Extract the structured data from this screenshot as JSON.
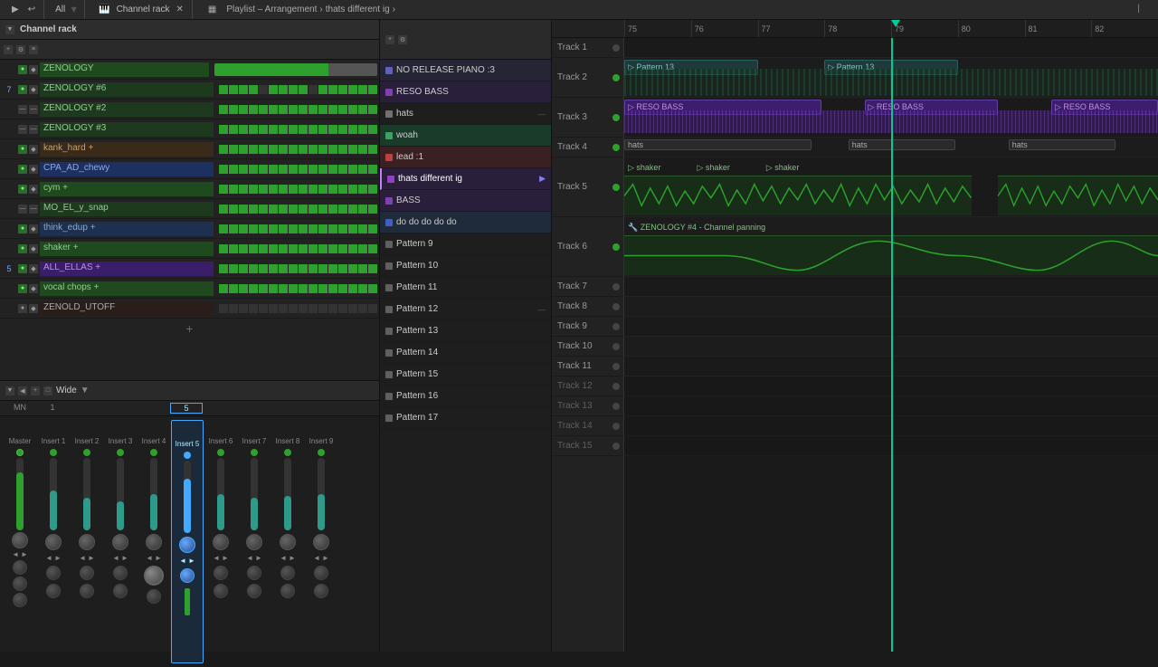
{
  "topbar": {
    "left_controls": [
      "▶",
      "↩"
    ],
    "channel_rack_label": "Channel rack",
    "playlist_label": "Playlist – Arrangement",
    "breadcrumb_separator": "›",
    "project_name": "thats different ig",
    "all_label": "All"
  },
  "channel_rack": {
    "title": "Channel rack",
    "channels": [
      {
        "num": "",
        "name": "ZENOLOGY",
        "style": "green",
        "pads": 16
      },
      {
        "num": "7",
        "name": "ZENOLOGY #6",
        "style": "green",
        "pads": 16
      },
      {
        "num": "",
        "name": "ZENOLOGY #2",
        "style": "green",
        "pads": 16
      },
      {
        "num": "",
        "name": "ZENOLOGY #3",
        "style": "green",
        "pads": 16
      },
      {
        "num": "",
        "name": "kank_hard +",
        "style": "green",
        "pads": 16
      },
      {
        "num": "",
        "name": "CPA_AD_chewy",
        "style": "green",
        "pads": 16
      },
      {
        "num": "",
        "name": "cym +",
        "style": "green",
        "pads": 16
      },
      {
        "num": "",
        "name": "MO_EL_y_snap",
        "style": "green",
        "pads": 16
      },
      {
        "num": "",
        "name": "think_edup +",
        "style": "green",
        "pads": 16
      },
      {
        "num": "",
        "name": "shaker +",
        "style": "green",
        "pads": 16
      },
      {
        "num": "5",
        "name": "ALL_ELLAS +",
        "style": "green",
        "pads": 16
      },
      {
        "num": "",
        "name": "vocal chops +",
        "style": "green",
        "pads": 16
      },
      {
        "num": "",
        "name": "ZENOLD_UTOFF",
        "style": "green",
        "pads": 16
      }
    ]
  },
  "mixer": {
    "label": "Wide",
    "channels": [
      "Master",
      "Insert 1",
      "Insert 2",
      "Insert 3",
      "Insert 4",
      "Insert 5",
      "Insert 6",
      "Insert 7",
      "Insert 8",
      "Insert 9"
    ],
    "active_channel": 5
  },
  "patterns": [
    {
      "name": "NO RELEASE PIANO :3",
      "color": "#6060c0",
      "active": false
    },
    {
      "name": "RESO BASS",
      "color": "#8040b0",
      "active": false
    },
    {
      "name": "hats",
      "color": "#606060",
      "active": false
    },
    {
      "name": "woah",
      "color": "#40a060",
      "active": false
    },
    {
      "name": "lead :1",
      "color": "#c04040",
      "active": false
    },
    {
      "name": "thats different ig",
      "color": "#9040c0",
      "active": true
    },
    {
      "name": "BASS",
      "color": "#8040b0",
      "active": false
    },
    {
      "name": "do do do do do",
      "color": "#4060c0",
      "active": false
    },
    {
      "name": "Pattern 9",
      "color": "#606060",
      "active": false
    },
    {
      "name": "Pattern 10",
      "color": "#606060",
      "active": false
    },
    {
      "name": "Pattern 11",
      "color": "#606060",
      "active": false
    },
    {
      "name": "Pattern 12",
      "color": "#606060",
      "active": false
    },
    {
      "name": "Pattern 13",
      "color": "#606060",
      "active": false
    },
    {
      "name": "Pattern 14",
      "color": "#606060",
      "active": false
    },
    {
      "name": "Pattern 15",
      "color": "#606060",
      "active": false
    },
    {
      "name": "Pattern 16",
      "color": "#606060",
      "active": false
    },
    {
      "name": "Pattern 17",
      "color": "#606060",
      "active": false
    }
  ],
  "arrangement": {
    "title": "Playlist – Arrangement",
    "project": "thats different ig",
    "tracks": [
      {
        "id": 1,
        "label": "Track 1",
        "height": "small"
      },
      {
        "id": 2,
        "label": "Track 2",
        "height": "small"
      },
      {
        "id": 3,
        "label": "Track 3",
        "height": "small"
      },
      {
        "id": 4,
        "label": "Track 4",
        "height": "small"
      },
      {
        "id": 5,
        "label": "Track 5",
        "height": "tall"
      },
      {
        "id": 6,
        "label": "Track 6",
        "height": "tall"
      },
      {
        "id": 7,
        "label": "Track 7",
        "height": "small"
      },
      {
        "id": 8,
        "label": "Track 8",
        "height": "small"
      },
      {
        "id": 9,
        "label": "Track 9",
        "height": "small"
      },
      {
        "id": 10,
        "label": "Track 10",
        "height": "small"
      },
      {
        "id": 11,
        "label": "Track 11",
        "height": "small"
      },
      {
        "id": 12,
        "label": "Track 12",
        "height": "small"
      },
      {
        "id": 13,
        "label": "Track 13",
        "height": "small"
      },
      {
        "id": 14,
        "label": "Track 14",
        "height": "small"
      },
      {
        "id": 15,
        "label": "Track 15",
        "height": "small"
      }
    ],
    "timeline_marks": [
      "75",
      "76",
      "77",
      "78",
      "79",
      "80",
      "81",
      "82"
    ],
    "playhead_position": "305"
  }
}
